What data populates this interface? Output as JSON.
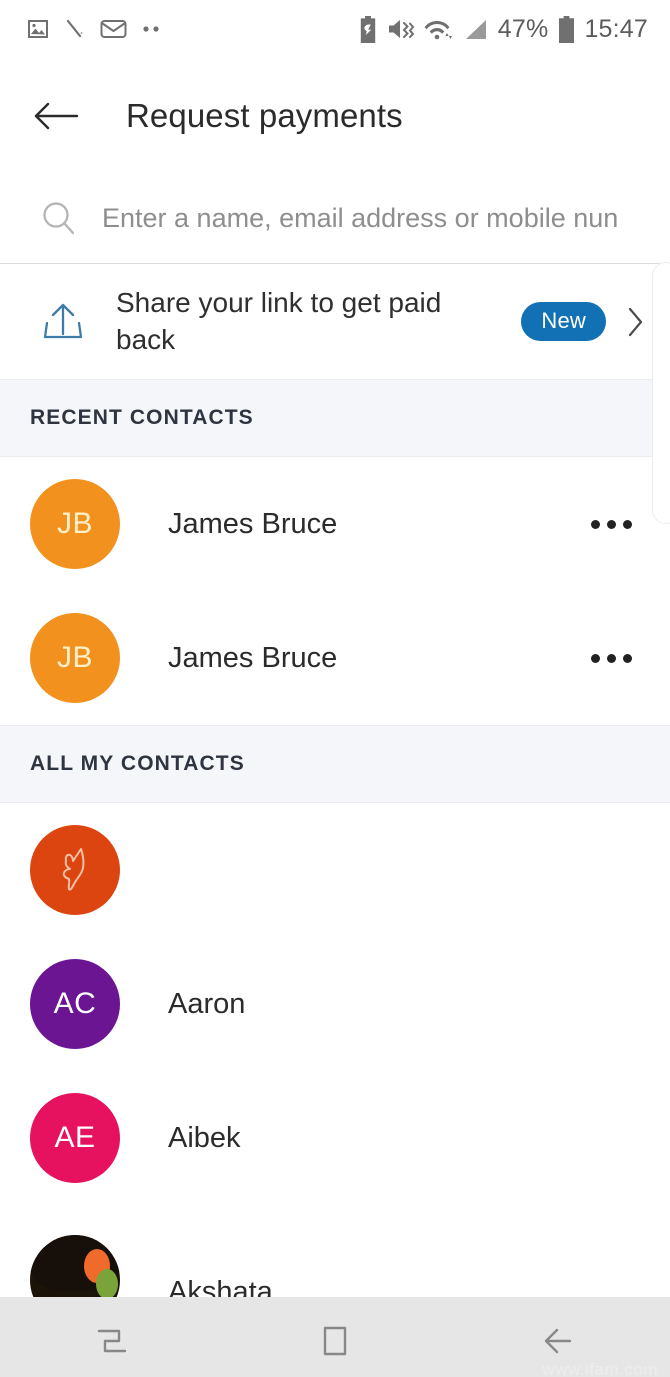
{
  "status_bar": {
    "left_icons": [
      "image-icon",
      "pen-slash-icon",
      "envelope-icon",
      "more-dots-icon"
    ],
    "right_icons": [
      "battery-saver-icon",
      "mute-vibrate-icon",
      "wifi-icon",
      "signal-icon",
      "battery-icon"
    ],
    "battery_percent": "47%",
    "time": "15:47"
  },
  "header": {
    "back_icon": "back-arrow-icon",
    "title": "Request payments"
  },
  "search": {
    "icon": "search-icon",
    "placeholder": "Enter a name, email address or mobile nun",
    "value": ""
  },
  "share_link": {
    "icon": "share-upload-icon",
    "title": "Share your link to get paid back",
    "badge": "New",
    "badge_color": "#1270b4",
    "chevron": "chevron-right-icon"
  },
  "sections": [
    {
      "id": "recent-contacts",
      "title": "RECENT CONTACTS",
      "contacts": [
        {
          "name": "James Bruce",
          "initials": "JB",
          "color": "#f2911e",
          "text_color": "#fff0c9",
          "has_menu": true
        },
        {
          "name": "James Bruce",
          "initials": "JB",
          "color": "#f2911e",
          "text_color": "#fff0c9",
          "has_menu": true
        }
      ]
    },
    {
      "id": "all-my-contacts",
      "title": "ALL MY CONTACTS",
      "contacts": [
        {
          "name": "",
          "initials": "",
          "color": "#dd4510",
          "text_color": "#f7c4a8",
          "has_menu": false,
          "avatar_glyph": "fox-head-outline-icon"
        },
        {
          "name": "Aaron",
          "initials": "AC",
          "color": "#6b1592",
          "text_color": "#ffffff",
          "has_menu": false
        },
        {
          "name": "Aibek",
          "initials": "AE",
          "color": "#e6115f",
          "text_color": "#ffffff",
          "has_menu": false
        },
        {
          "name": "Akshata",
          "initials": "",
          "color": "#1b1208",
          "text_color": "#ffffff",
          "has_menu": false,
          "avatar_photo": true
        }
      ]
    }
  ],
  "nav_bar": {
    "recents_icon": "recents-icon",
    "home_icon": "home-icon",
    "back_icon": "nav-back-icon"
  },
  "watermark": "www.ifam.com"
}
